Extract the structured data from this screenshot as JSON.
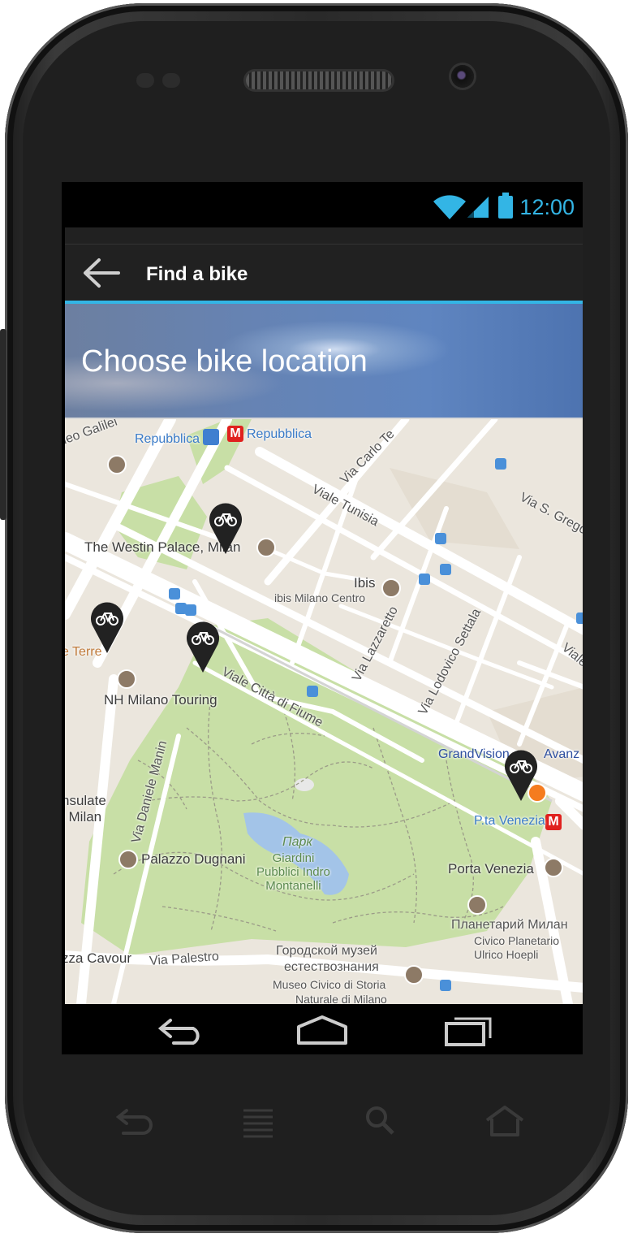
{
  "status_bar": {
    "time": "12:00",
    "wifi_icon": "wifi-icon",
    "signal_icon": "signal-icon",
    "battery_icon": "battery-icon",
    "accent_color": "#33b5e5"
  },
  "action_bar": {
    "back_icon": "arrow-back-icon",
    "title": "Find a bike"
  },
  "banner": {
    "heading": "Choose bike location"
  },
  "map": {
    "labels": {
      "galilei": "leo Galilei",
      "repubblica_bus": "Repubblica",
      "repubblica_metro": "Repubblica",
      "carlo_tenca": "Via Carlo Te",
      "viale_tunisia": "Viale Tunisia",
      "via_s_gregorio": "Via S. Grego",
      "westin": "The Westin Palace, Milan",
      "ibis": "Ibis",
      "ibis_centro": "ibis Milano Centro",
      "lazzaretto": "Via Lazzaretto",
      "settala": "Via Lodovico Settala",
      "viale_edge": "Viale",
      "terre": "e Terre",
      "nh": "NH Milano Touring",
      "citta_fiume": "Viale Città di Fiume",
      "daniele_manin": "Via Daniele Manin",
      "grandvision": "GrandVision",
      "avanz": "Avanz",
      "consulate_1": "nsulate",
      "consulate_2": "l Milan",
      "park_ital": "Парк",
      "giardini": "Giardini\nPubblici Indro\nMontanelli",
      "pta_venezia": "P.ta Venezia",
      "porta_venezia": "Porta Venezia",
      "palazzo": "Palazzo Dugnani",
      "planetarium_ru": "Планетарий Милан",
      "planetarium_it": "Civico Planetario\nUlrico Hoepli",
      "cavour": "zza Cavour",
      "palestro": "Via Palestro",
      "museum_ru_1": "Городской музей",
      "museum_ru_2": "естествознания",
      "museum_it_1": "Museo Civico di Storia",
      "museum_it_2": "Naturale di Milano",
      "metro_letter": "M",
      "restaurant_glyph": "🍴"
    },
    "bike_pins": [
      "bike-pin-westin",
      "bike-pin-terre",
      "bike-pin-touring",
      "bike-pin-venezia"
    ],
    "park_color": "#c8dfa6",
    "road_color": "#ffffff"
  },
  "nav_bar": {
    "back_icon": "nav-back-icon",
    "home_icon": "nav-home-icon",
    "recents_icon": "nav-recents-icon"
  },
  "hardware_keys": [
    "hw-back-icon",
    "hw-menu-icon",
    "hw-search-icon",
    "hw-home-icon"
  ]
}
